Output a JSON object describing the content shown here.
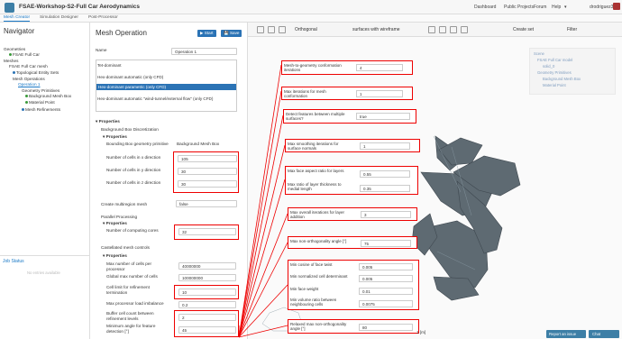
{
  "header": {
    "project_title": "FSAE-Workshop-S2-Full Car Aerodynamics",
    "links": [
      "Dashboard",
      "Public Projects",
      "Forum",
      "Help"
    ],
    "help_caret": "▾",
    "username": "drodriguez32"
  },
  "tabs": [
    "Mesh Creator",
    "Simulation Designer",
    "Post-Processor"
  ],
  "navigator": {
    "title": "Navigator",
    "items": [
      {
        "label": "Geometries"
      },
      {
        "label": "FSAE Full Car"
      },
      {
        "label": "Meshes"
      },
      {
        "label": "FSAE Full Car mesh"
      },
      {
        "label": "Topological Entity Sets"
      },
      {
        "label": "Mesh Operations"
      },
      {
        "label": "Operation 1"
      },
      {
        "label": "Geometry Primitives"
      },
      {
        "label": "Background Mesh Box"
      },
      {
        "label": "Material Point"
      },
      {
        "label": "Mesh Refinements"
      }
    ],
    "colors": {
      "green": "#3a9a3a",
      "blue": "#2b73b5"
    }
  },
  "job_status": {
    "title": "Job Status",
    "empty_text": "No entries available"
  },
  "mesh_operation": {
    "title": "Mesh Operation",
    "start_label": "▶ Start",
    "save_label": "💾 Save",
    "name_label": "Name",
    "name_value": "Operation 1",
    "types": [
      "Tet-dominant",
      "Hex-dominant automatic (only CFD)",
      "Hex-dominant parametric (only CFD)",
      "Hex-dominant automatic \"wind-tunnel/external flow\" (only CFD)"
    ],
    "properties_label": "Properties",
    "bbox_title": "Background Box Discretization",
    "sub_properties": "Properties",
    "bbox_primitive_label": "Bounding Box geometry primitive",
    "bbox_primitive_value": "Background Mesh Box",
    "cells_x_label": "Number of cells in x direction",
    "cells_x": "105",
    "cells_y_label": "Number of cells in y direction",
    "cells_y": "30",
    "cells_z_label": "Number of cells in z direction",
    "cells_z": "30",
    "multiregion_label": "Create multiregion mesh",
    "multiregion_value": "false",
    "parallel_title": "Parallel Processing",
    "cores_label": "Number of computing cores",
    "cores_value": "32",
    "castellated_title": "Castellated mesh controls",
    "max_cells_proc_label": "Max number of cells per processor",
    "max_cells_proc": "40000000",
    "global_max_cells_label": "Global max number of cells",
    "global_max_cells": "100000000",
    "cell_limit_label": "Cell limit for refinement termination",
    "cell_limit": "10",
    "max_load_label": "Max processor load imbalance",
    "max_load": "0.2",
    "buffer_cells_label": "Buffer cell count between refinement levels",
    "buffer_cells": "2",
    "min_angle_label": "Minimum angle for feature detection [°]",
    "min_angle": "45"
  },
  "viewport": {
    "view_label": "Orthogonal",
    "render_label": "surfaces with wireframe",
    "create_set_label": "Create set",
    "filter_label": "Filter",
    "scale_label": "1 [m]",
    "scene_tree": [
      "Scene",
      "FSAE Full Car model",
      "solid_0",
      "Geometry Primitives",
      "Background Mesh Box",
      "Material Point"
    ]
  },
  "callouts": {
    "c1_label": "Mesh-to-geometry conformation iterations",
    "c1_value": "4",
    "c2_label": "Max iterations for mesh conformation",
    "c2_value": "1",
    "c3_label": "Detect features between multiple surfaces?",
    "c3_value": "true",
    "c4_label": "Max smoothing iterations for surface normals",
    "c4_value": "1",
    "c5a_label": "Max face aspect ratio for layers",
    "c5a_value": "0.55",
    "c5b_label": "Max ratio of layer thickness to medial length",
    "c5b_value": "0.35",
    "c6_label": "Max overall iterations for layer addition",
    "c6_value": "3",
    "c7_label": "Max non-orthogonality angle [°]",
    "c7_value": "75",
    "c8a_label": "Min cosine of face twist",
    "c8a_value": "0.005",
    "c8b_label": "Min normalized cell determinant",
    "c8b_value": "0.005",
    "c8c_label": "Min face weight",
    "c8c_value": "0.01",
    "c8d_label": "Min volume ratio between neighbouring cells",
    "c8d_value": "0.0075",
    "c9_label": "Relaxed max non-orthogonality angle [°]",
    "c9_value": "80"
  },
  "bottom": {
    "report_label": "Report an issue",
    "chat_label": "Chat"
  },
  "colors": {
    "accent": "#2b73b5",
    "highlight": "#e00000"
  }
}
